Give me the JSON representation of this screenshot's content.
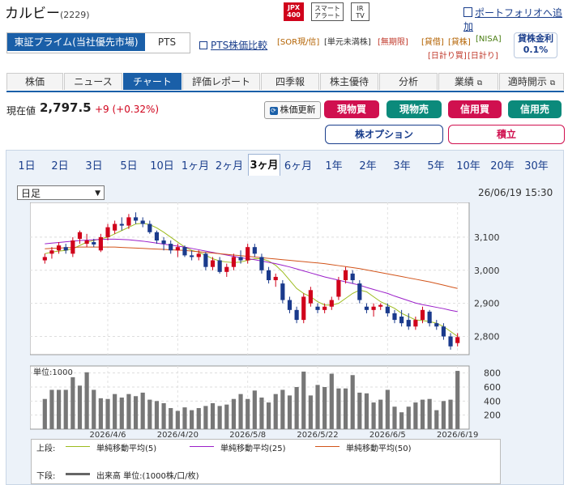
{
  "stock": {
    "name": "カルビー",
    "code": "(2229)"
  },
  "header": {
    "jpx": "JPX",
    "jpx400": "400",
    "smart_l1": "スマート",
    "smart_l2": "アラート",
    "ir_l1": "IR",
    "ir_l2": "TV",
    "portfolio_link": "ポートフォリオへ追加"
  },
  "market": {
    "primary": "東証プライム(当社優先市場)",
    "pts": "PTS",
    "pts_compare": "PTS株価比較"
  },
  "badges": {
    "sor": "[SOR現/信]",
    "tangen": "[単元未満株]",
    "unlimited": "[無期限]",
    "lending": "[貸借]",
    "kashi": "[貸株]",
    "nisa": "[NISA]",
    "daycredit": "[日計り買]",
    "daycredit2": "[日計り]"
  },
  "loan": {
    "label": "貸株金利",
    "rate": "0.1%"
  },
  "tabs": [
    "株価",
    "ニュース",
    "チャート",
    "評価レポート",
    "四季報",
    "株主優待",
    "分析",
    "業績",
    "適時開示"
  ],
  "active_tab": "チャート",
  "quote": {
    "label": "現在値",
    "price": "2,797.5",
    "change": "+9 (+0.32%)"
  },
  "buttons": {
    "refresh": "株価更新",
    "genbuy": "現物買",
    "gensell": "現物売",
    "crbuy": "信用買",
    "crsell": "信用売",
    "option": "株オプション",
    "tsumitate": "積立"
  },
  "periods": [
    "1日",
    "2日",
    "3日",
    "5日",
    "10日",
    "1ヶ月",
    "2ヶ月",
    "3ヶ月",
    "6ヶ月",
    "1年",
    "2年",
    "3年",
    "5年",
    "10年",
    "20年",
    "30年"
  ],
  "active_period": "3ヶ月",
  "interval": "日足",
  "datetime": "26/06/19 15:30",
  "legend": {
    "upper_label": "上段:",
    "ma5": "単純移動平均(5)",
    "ma25": "単純移動平均(25)",
    "ma50": "単純移動平均(50)",
    "lower_label": "下段:",
    "volume": "出来高 単位:(1000株/口/枚)"
  },
  "colors": {
    "up": "#d0021b",
    "down": "#1a3a8c",
    "ma5": "#9dbb1e",
    "ma25": "#9b1fc9",
    "ma50": "#d2541a",
    "volume": "#777777"
  },
  "chart_data": {
    "type": "candlestick",
    "price_ticks": [
      3100,
      3000,
      2900,
      2800
    ],
    "volume_ticks": [
      800,
      600,
      400,
      200
    ],
    "volume_unit_label": "単位:1000",
    "x_tick_labels": [
      "2026/4/6",
      "2026/4/20",
      "2026/5/8",
      "2026/5/22",
      "2026/6/5",
      "2026/6/19"
    ],
    "x_tick_index": [
      9,
      19,
      29,
      39,
      49,
      59
    ],
    "ohlc": [
      [
        3030,
        3050,
        3020,
        3040
      ],
      [
        3050,
        3070,
        3035,
        3060
      ],
      [
        3060,
        3085,
        3050,
        3075
      ],
      [
        3070,
        3080,
        3050,
        3060
      ],
      [
        3050,
        3100,
        3040,
        3090
      ],
      [
        3095,
        3120,
        3080,
        3115
      ],
      [
        3080,
        3110,
        3070,
        3090
      ],
      [
        3085,
        3095,
        3070,
        3078
      ],
      [
        3060,
        3110,
        3055,
        3100
      ],
      [
        3100,
        3140,
        3090,
        3130
      ],
      [
        3120,
        3150,
        3110,
        3140
      ],
      [
        3140,
        3160,
        3120,
        3135
      ],
      [
        3135,
        3170,
        3125,
        3160
      ],
      [
        3160,
        3175,
        3140,
        3150
      ],
      [
        3150,
        3160,
        3130,
        3140
      ],
      [
        3140,
        3150,
        3110,
        3115
      ],
      [
        3115,
        3120,
        3080,
        3090
      ],
      [
        3090,
        3100,
        3060,
        3080
      ],
      [
        3080,
        3090,
        3050,
        3060
      ],
      [
        3060,
        3080,
        3040,
        3070
      ],
      [
        3070,
        3075,
        3040,
        3045
      ],
      [
        3045,
        3060,
        3030,
        3040
      ],
      [
        3040,
        3060,
        3030,
        3050
      ],
      [
        3050,
        3055,
        3000,
        3010
      ],
      [
        3010,
        3040,
        3000,
        3030
      ],
      [
        3030,
        3040,
        2990,
        2995
      ],
      [
        2995,
        3020,
        2980,
        3010
      ],
      [
        3010,
        3050,
        3000,
        3040
      ],
      [
        3040,
        3060,
        3020,
        3030
      ],
      [
        3030,
        3080,
        3020,
        3070
      ],
      [
        3070,
        3080,
        3040,
        3050
      ],
      [
        3040,
        3050,
        2990,
        3000
      ],
      [
        3000,
        3010,
        2960,
        2970
      ],
      [
        2970,
        2990,
        2950,
        2980
      ],
      [
        2960,
        2970,
        2900,
        2910
      ],
      [
        2910,
        2920,
        2870,
        2880
      ],
      [
        2880,
        2890,
        2840,
        2850
      ],
      [
        2850,
        2930,
        2840,
        2920
      ],
      [
        2900,
        2950,
        2890,
        2940
      ],
      [
        2890,
        2900,
        2870,
        2880
      ],
      [
        2880,
        2900,
        2870,
        2890
      ],
      [
        2890,
        2920,
        2880,
        2910
      ],
      [
        2920,
        2980,
        2910,
        2970
      ],
      [
        2970,
        3010,
        2960,
        3000
      ],
      [
        2990,
        3000,
        2960,
        2970
      ],
      [
        2960,
        2970,
        2900,
        2910
      ],
      [
        2890,
        2900,
        2870,
        2880
      ],
      [
        2880,
        2900,
        2860,
        2890
      ],
      [
        2890,
        2900,
        2880,
        2895
      ],
      [
        2890,
        2900,
        2860,
        2870
      ],
      [
        2870,
        2880,
        2840,
        2850
      ],
      [
        2860,
        2880,
        2830,
        2840
      ],
      [
        2850,
        2870,
        2820,
        2830
      ],
      [
        2830,
        2860,
        2820,
        2850
      ],
      [
        2850,
        2890,
        2840,
        2880
      ],
      [
        2875,
        2880,
        2830,
        2840
      ],
      [
        2840,
        2850,
        2820,
        2830
      ],
      [
        2830,
        2840,
        2790,
        2800
      ],
      [
        2800,
        2810,
        2760,
        2770
      ],
      [
        2780,
        2810,
        2770,
        2798
      ]
    ],
    "ma5": [
      3050,
      3055,
      3058,
      3060,
      3065,
      3075,
      3085,
      3090,
      3095,
      3100,
      3110,
      3120,
      3130,
      3140,
      3142,
      3138,
      3128,
      3115,
      3100,
      3085,
      3070,
      3060,
      3055,
      3045,
      3035,
      3028,
      3025,
      3023,
      3025,
      3030,
      3035,
      3035,
      3028,
      3015,
      2995,
      2970,
      2945,
      2930,
      2920,
      2905,
      2895,
      2895,
      2900,
      2915,
      2930,
      2940,
      2935,
      2920,
      2905,
      2895,
      2885,
      2870,
      2860,
      2850,
      2848,
      2845,
      2840,
      2830,
      2815,
      2800
    ],
    "ma25": [
      3080,
      3082,
      3084,
      3086,
      3088,
      3090,
      3091,
      3092,
      3093,
      3094,
      3094,
      3093,
      3092,
      3090,
      3088,
      3085,
      3082,
      3079,
      3076,
      3073,
      3070,
      3066,
      3062,
      3058,
      3054,
      3050,
      3046,
      3042,
      3038,
      3035,
      3032,
      3028,
      3024,
      3020,
      3015,
      3010,
      3004,
      2998,
      2992,
      2986,
      2980,
      2975,
      2970,
      2965,
      2960,
      2955,
      2948,
      2942,
      2936,
      2930,
      2922,
      2915,
      2908,
      2901,
      2896,
      2892,
      2888,
      2884,
      2879,
      2875
    ],
    "ma50": [
      3065,
      3066,
      3067,
      3068,
      3069,
      3070,
      3070,
      3070,
      3070,
      3070,
      3070,
      3069,
      3068,
      3067,
      3066,
      3065,
      3064,
      3063,
      3062,
      3061,
      3060,
      3058,
      3056,
      3054,
      3052,
      3050,
      3048,
      3046,
      3044,
      3042,
      3040,
      3038,
      3036,
      3034,
      3032,
      3030,
      3028,
      3026,
      3024,
      3022,
      3020,
      3017,
      3014,
      3011,
      3008,
      3005,
      3001,
      2997,
      2993,
      2989,
      2985,
      2981,
      2977,
      2973,
      2969,
      2965,
      2960,
      2955,
      2950,
      2945
    ],
    "volume": [
      430,
      560,
      560,
      560,
      740,
      620,
      810,
      560,
      440,
      430,
      500,
      450,
      500,
      470,
      520,
      420,
      400,
      370,
      300,
      260,
      310,
      270,
      300,
      330,
      370,
      330,
      350,
      430,
      500,
      430,
      550,
      450,
      380,
      500,
      560,
      480,
      600,
      820,
      480,
      630,
      600,
      790,
      580,
      580,
      770,
      520,
      510,
      380,
      420,
      560,
      320,
      240,
      320,
      380,
      420,
      430,
      270,
      400,
      420,
      830
    ]
  }
}
